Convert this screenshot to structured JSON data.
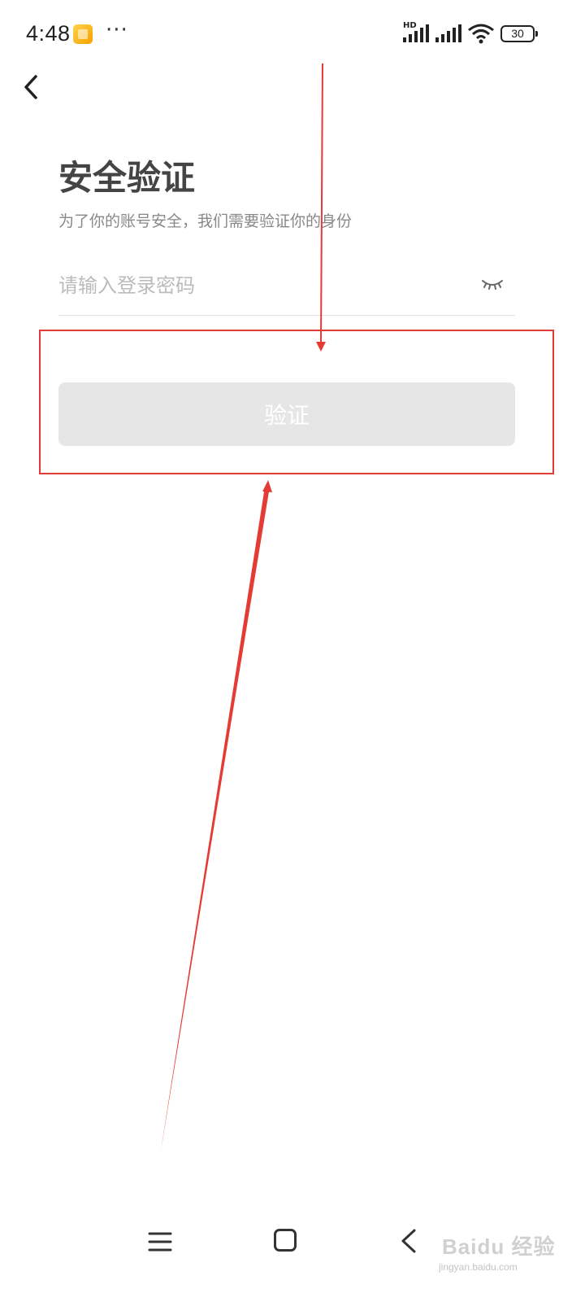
{
  "status_bar": {
    "time": "4:48",
    "more": "···",
    "network_tag": "HD",
    "battery": "30",
    "icons": [
      "app-notification-icon",
      "signal-icon",
      "signal-icon",
      "wifi-icon",
      "battery-icon"
    ]
  },
  "header": {
    "back_icon": "chevron-left-icon"
  },
  "main": {
    "title": "安全验证",
    "subtitle": "为了你的账号安全，我们需要验证你的身份",
    "password": {
      "placeholder": "请输入登录密码",
      "value": "",
      "toggle_icon": "eye-closed-icon"
    },
    "verify_button": {
      "label": "验证",
      "state": "disabled"
    }
  },
  "annotation": {
    "color": "#e53b35"
  },
  "nav_bar": {
    "icons": [
      "menu-icon",
      "home-icon",
      "back-icon"
    ]
  },
  "watermark": {
    "text": "Baidu 经验",
    "url": "jingyan.baidu.com"
  }
}
